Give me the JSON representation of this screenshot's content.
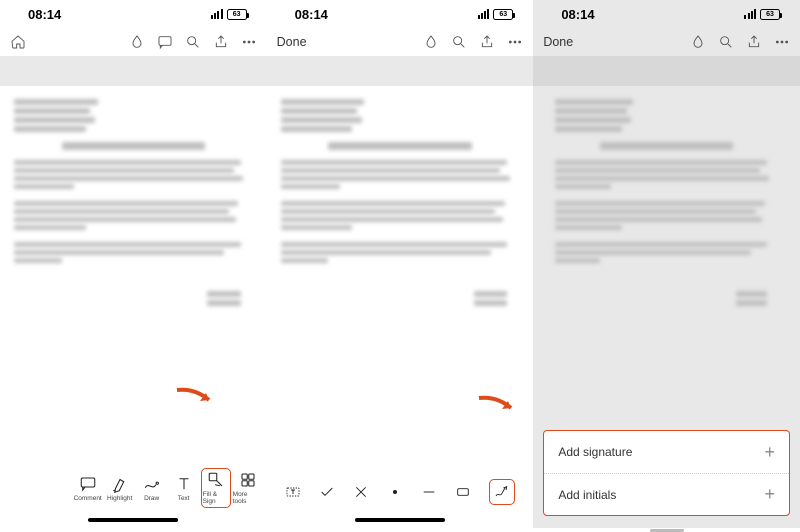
{
  "status": {
    "time": "08:14",
    "battery": "63"
  },
  "nav": {
    "done": "Done"
  },
  "toolbar1": {
    "comment": "Comment",
    "highlight": "Highlight",
    "draw": "Draw",
    "text": "Text",
    "fill_sign": "Fill & Sign",
    "more_tools": "More tools"
  },
  "sheet": {
    "add_signature": "Add signature",
    "add_initials": "Add initials"
  }
}
